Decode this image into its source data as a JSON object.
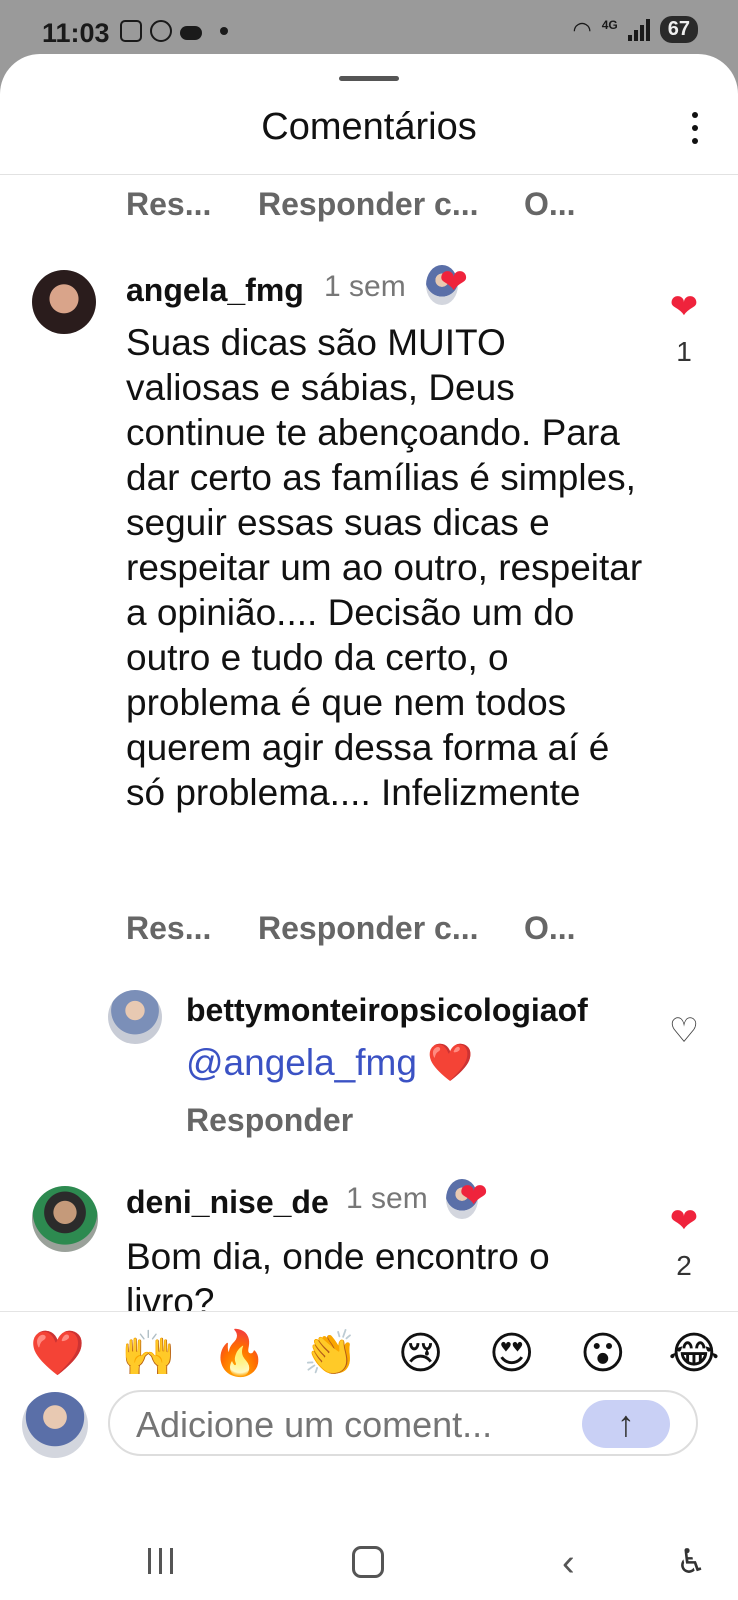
{
  "status_bar": {
    "time": "11:03",
    "network": "4G",
    "battery": "67"
  },
  "sheet": {
    "title": "Comentários"
  },
  "action_labels": {
    "reply": "Res...",
    "reply_to": "Responder c...",
    "other": "O..."
  },
  "comments": [
    {
      "username": "angela_fmg",
      "time": "1 sem",
      "text": "Suas dicas são MUITO valiosas e sábias, Deus continue te abençoando. Para dar certo as famílias é simples, seguir essas suas dicas e respeitar um ao outro, respeitar a opinião.... Decisão um do outro e tudo da certo, o problema é que nem todos querem agir dessa forma aí é só problema.... Infelizmente",
      "likes": "1",
      "liked": true
    },
    {
      "username": "deni_nise_de",
      "time": "1 sem",
      "text": "Bom dia, onde encontro o livro?",
      "likes": "2",
      "liked": true
    }
  ],
  "reply": {
    "username": "bettymonteiropsicologiaof",
    "mention": "@angela_fmg",
    "emoji": "❤️",
    "reply_label": "Responder"
  },
  "emoji_bar": [
    "❤️",
    "🙌",
    "🔥",
    "👏",
    "😢",
    "😍",
    "😮",
    "😂"
  ],
  "composer": {
    "placeholder": "Adicione um coment..."
  },
  "icons": {
    "heart": "❤",
    "heart_outline": "♡",
    "send": "↑",
    "back": "‹",
    "accessibility": "♿"
  },
  "colors": {
    "like_red": "#ef233c",
    "mention_blue": "#3b52c4",
    "send_bg": "#c9d0f5"
  }
}
